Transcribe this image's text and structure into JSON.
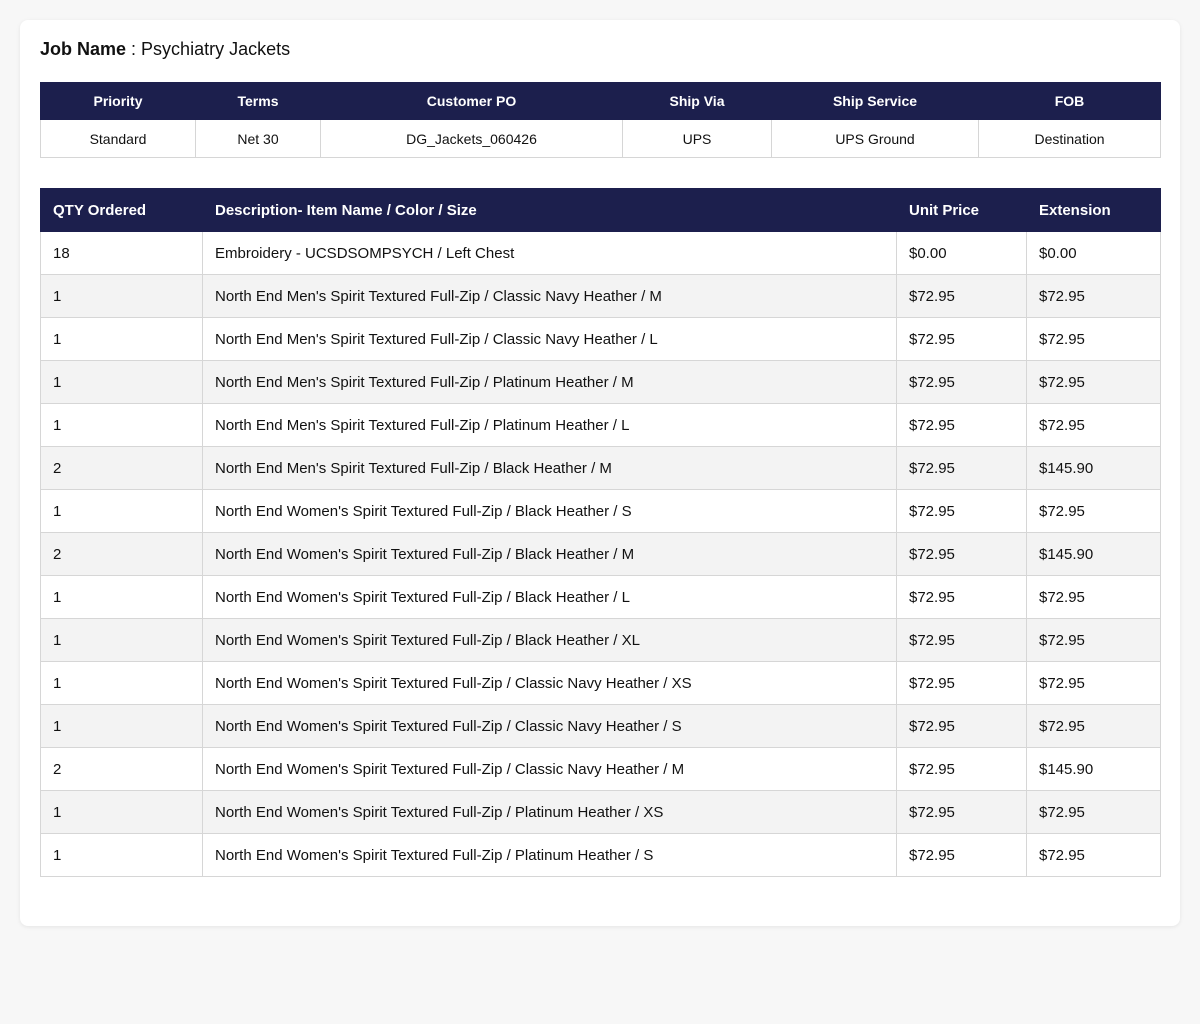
{
  "job": {
    "label": "Job Name",
    "separator": " : ",
    "value": "Psychiatry Jackets"
  },
  "order_info": {
    "headers": [
      "Priority",
      "Terms",
      "Customer PO",
      "Ship Via",
      "Ship Service",
      "FOB"
    ],
    "values": [
      "Standard",
      "Net 30",
      "DG_Jackets_060426",
      "UPS",
      "UPS Ground",
      "Destination"
    ]
  },
  "items": {
    "headers": [
      "QTY Ordered",
      "Description- Item Name / Color / Size",
      "Unit Price",
      "Extension"
    ],
    "rows": [
      [
        "18",
        "Embroidery - UCSDSOMPSYCH / Left Chest",
        "$0.00",
        "$0.00"
      ],
      [
        "1",
        "North End Men's Spirit Textured Full-Zip / Classic Navy Heather / M",
        "$72.95",
        "$72.95"
      ],
      [
        "1",
        "North End Men's Spirit Textured Full-Zip / Classic Navy Heather / L",
        "$72.95",
        "$72.95"
      ],
      [
        "1",
        "North End Men's Spirit Textured Full-Zip / Platinum Heather / M",
        "$72.95",
        "$72.95"
      ],
      [
        "1",
        "North End Men's Spirit Textured Full-Zip / Platinum Heather / L",
        "$72.95",
        "$72.95"
      ],
      [
        "2",
        "North End Men's Spirit Textured Full-Zip / Black Heather / M",
        "$72.95",
        "$145.90"
      ],
      [
        "1",
        "North End Women's Spirit Textured Full-Zip / Black Heather / S",
        "$72.95",
        "$72.95"
      ],
      [
        "2",
        "North End Women's Spirit Textured Full-Zip / Black Heather / M",
        "$72.95",
        "$145.90"
      ],
      [
        "1",
        "North End Women's Spirit Textured Full-Zip / Black Heather / L",
        "$72.95",
        "$72.95"
      ],
      [
        "1",
        "North End Women's Spirit Textured Full-Zip / Black Heather / XL",
        "$72.95",
        "$72.95"
      ],
      [
        "1",
        "North End Women's Spirit Textured Full-Zip / Classic Navy Heather / XS",
        "$72.95",
        "$72.95"
      ],
      [
        "1",
        "North End Women's Spirit Textured Full-Zip / Classic Navy Heather / S",
        "$72.95",
        "$72.95"
      ],
      [
        "2",
        "North End Women's Spirit Textured Full-Zip / Classic Navy Heather / M",
        "$72.95",
        "$145.90"
      ],
      [
        "1",
        "North End Women's Spirit Textured Full-Zip / Platinum Heather / XS",
        "$72.95",
        "$72.95"
      ],
      [
        "1",
        "North End Women's Spirit Textured Full-Zip / Platinum Heather / S",
        "$72.95",
        "$72.95"
      ]
    ]
  },
  "colors": {
    "header_bg": "#1c1f4d",
    "header_text": "#ffffff",
    "row_alt_bg": "#f3f3f3",
    "border": "#d6d6d6"
  }
}
